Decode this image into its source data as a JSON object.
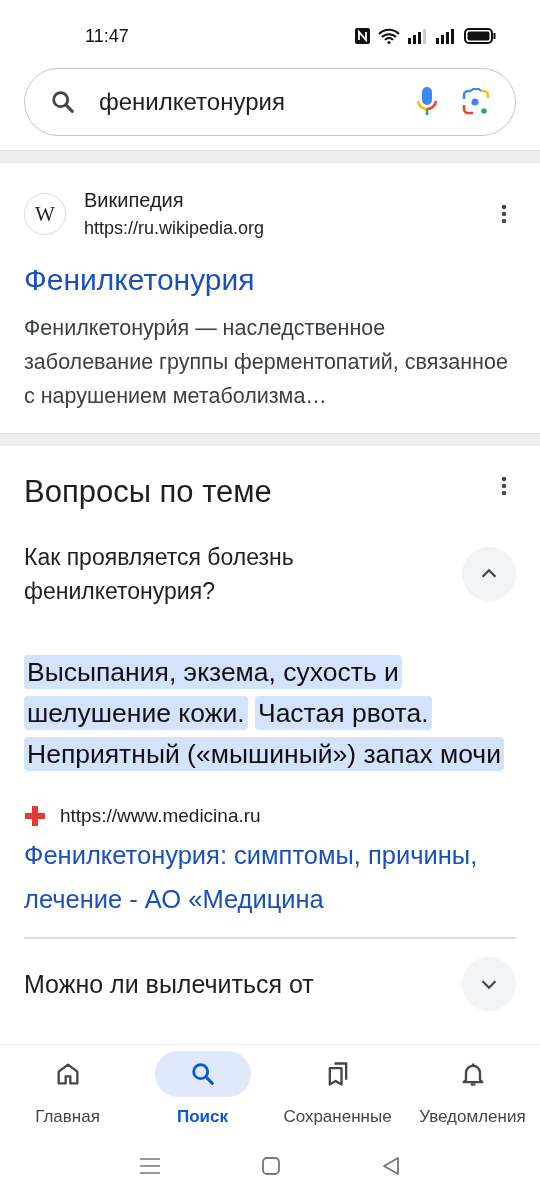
{
  "status_bar": {
    "time": "11:47"
  },
  "search": {
    "value": "фенилкетонурия"
  },
  "result": {
    "logo_letter": "W",
    "site": "Википедия",
    "url": "https://ru.wikipedia.org",
    "title": "Фенилкетонурия",
    "snippet": "Фенилкетонури́я — наследственное заболевание группы ферментопатий, связанное с нарушением метаболизма…"
  },
  "related": {
    "heading": "Вопросы по теме",
    "questions": [
      {
        "question": "Как проявляется болезнь фенилкетонурия?",
        "expanded": true,
        "answer": [
          {
            "text": "Высыпания, экзема, сухость и шелушение кожи.",
            "highlighted": true
          },
          {
            "text": "Частая рвота.",
            "highlighted": true
          },
          {
            "text": "Неприятный («мышиный») запах мочи",
            "highlighted": true
          }
        ],
        "source_url": "https://www.medicina.ru",
        "source_title": "Фенилкетонурия: симптомы, причины, лечение - АО «Медицина"
      },
      {
        "question": "Можно ли вылечиться от",
        "expanded": false
      }
    ]
  },
  "bottom_nav": [
    {
      "label": "Главная",
      "selected": false
    },
    {
      "label": "Поиск",
      "selected": true
    },
    {
      "label": "Сохраненные",
      "selected": false
    },
    {
      "label": "Уведомления",
      "selected": false
    }
  ]
}
